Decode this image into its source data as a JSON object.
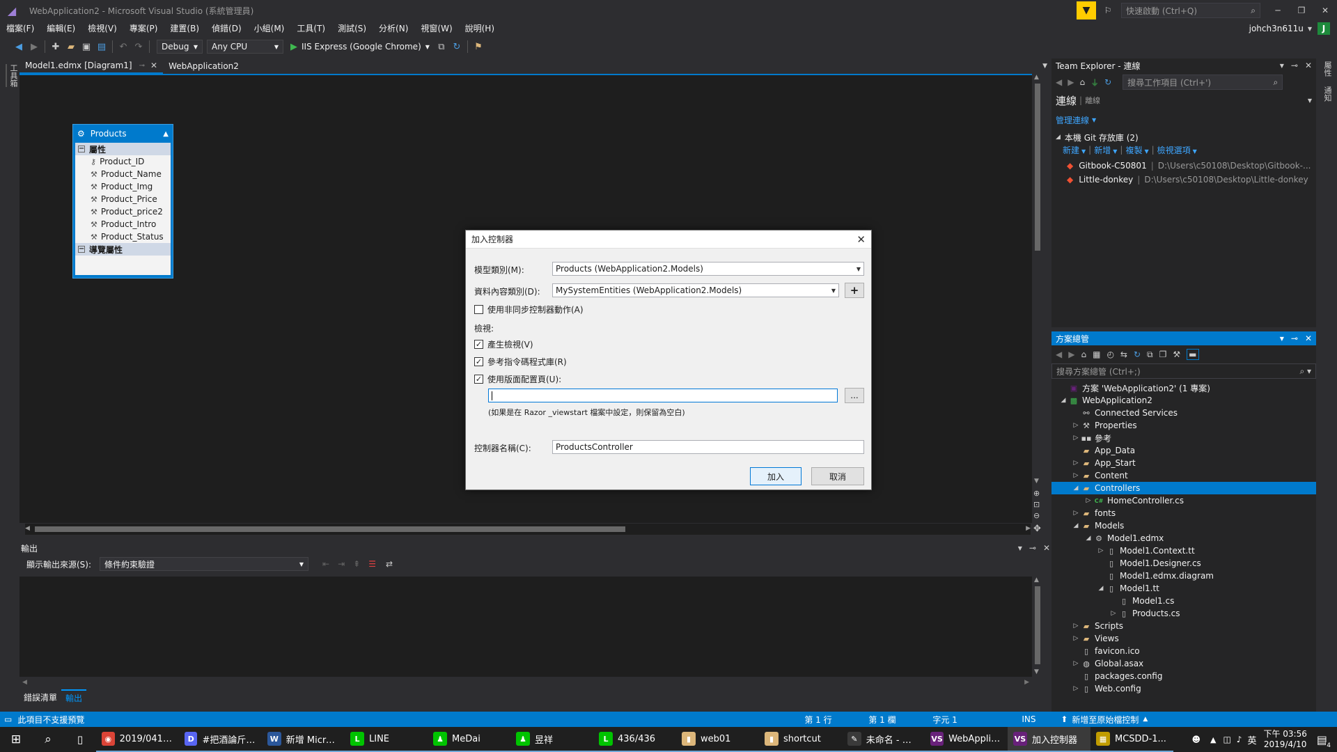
{
  "window": {
    "title": "WebApplication2 - Microsoft Visual Studio (系統管理員)",
    "quick_launch_placeholder": "快速啟動 (Ctrl+Q)",
    "user": "johch3n611u",
    "user_initial": "J"
  },
  "menu": [
    "檔案(F)",
    "編輯(E)",
    "檢視(V)",
    "專案(P)",
    "建置(B)",
    "偵錯(D)",
    "小組(M)",
    "工具(T)",
    "測試(S)",
    "分析(N)",
    "視窗(W)",
    "說明(H)"
  ],
  "toolbar": {
    "config": "Debug",
    "platform": "Any CPU",
    "run_target": "IIS Express (Google Chrome)"
  },
  "left_strip_label": "工具箱",
  "right_strip_labels": [
    "屬性",
    "通知"
  ],
  "doc_tabs": [
    {
      "label": "Model1.edmx [Diagram1]",
      "active": true
    },
    {
      "label": "WebApplication2",
      "active": false
    }
  ],
  "entity": {
    "name": "Products",
    "properties_header": "屬性",
    "properties": [
      "Product_ID",
      "Product_Name",
      "Product_Img",
      "Product_Price",
      "Product_price2",
      "Product_Intro",
      "Product_Status"
    ],
    "nav_header": "導覽屬性"
  },
  "dialog": {
    "title": "加入控制器",
    "model_class_label": "模型類別(M):",
    "model_class_value": "Products (WebApplication2.Models)",
    "context_class_label": "資料內容類別(D):",
    "context_class_value": "MySystemEntities (WebApplication2.Models)",
    "add_context_button": "+",
    "async_label": "使用非同步控制器動作(A)",
    "async_checked": false,
    "views_label": "檢視:",
    "generate_views_label": "產生檢視(V)",
    "generate_views_checked": true,
    "script_libs_label": "參考指令碼程式庫(R)",
    "script_libs_checked": true,
    "use_layout_label": "使用版面配置頁(U):",
    "use_layout_checked": true,
    "layout_value": "",
    "browse_button": "...",
    "layout_hint": "(如果是在 Razor _viewstart 檔案中設定，則保留為空白)",
    "controller_name_label": "控制器名稱(C):",
    "controller_name_value": "ProductsController",
    "add_button": "加入",
    "cancel_button": "取消"
  },
  "output": {
    "title": "輸出",
    "source_label": "顯示輸出來源(S):",
    "source_value": "條件約束驗證"
  },
  "bottom_tabs": [
    "錯誤清單",
    "輸出"
  ],
  "team_explorer": {
    "title": "Team Explorer - 連線",
    "search_placeholder": "搜尋工作項目 (Ctrl+')",
    "heading": "連線",
    "heading_sub": "離線",
    "manage_link": "管理連線",
    "repos_header": "本機 Git 存放庫 (2)",
    "actions": [
      "新建",
      "新增",
      "複製",
      "檢視選項"
    ],
    "repos": [
      {
        "name": "Gitbook-C50801",
        "path": "D:\\Users\\c50108\\Desktop\\Gitbook-..."
      },
      {
        "name": "Little-donkey",
        "path": "D:\\Users\\c50108\\Desktop\\Little-donkey"
      }
    ]
  },
  "solution_explorer": {
    "title": "方案總管",
    "search_placeholder": "搜尋方案總管 (Ctrl+;)",
    "items": [
      {
        "label": "方案 'WebApplication2' (1 專案)",
        "level": 0,
        "arrow": "",
        "icon": "sln"
      },
      {
        "label": "WebApplication2",
        "level": 0,
        "arrow": "down",
        "icon": "proj"
      },
      {
        "label": "Connected Services",
        "level": 1,
        "arrow": "",
        "icon": "svc"
      },
      {
        "label": "Properties",
        "level": 1,
        "arrow": "right",
        "icon": "wrench"
      },
      {
        "label": "參考",
        "level": 1,
        "arrow": "right",
        "icon": "ref"
      },
      {
        "label": "App_Data",
        "level": 1,
        "arrow": "",
        "icon": "folder"
      },
      {
        "label": "App_Start",
        "level": 1,
        "arrow": "right",
        "icon": "folder"
      },
      {
        "label": "Content",
        "level": 1,
        "arrow": "right",
        "icon": "folder"
      },
      {
        "label": "Controllers",
        "level": 1,
        "arrow": "down",
        "icon": "folder",
        "selected": true
      },
      {
        "label": "HomeController.cs",
        "level": 2,
        "arrow": "right",
        "icon": "cs"
      },
      {
        "label": "fonts",
        "level": 1,
        "arrow": "right",
        "icon": "folder"
      },
      {
        "label": "Models",
        "level": 1,
        "arrow": "down",
        "icon": "folder"
      },
      {
        "label": "Model1.edmx",
        "level": 2,
        "arrow": "down",
        "icon": "edmx"
      },
      {
        "label": "Model1.Context.tt",
        "level": 3,
        "arrow": "right",
        "icon": "file"
      },
      {
        "label": "Model1.Designer.cs",
        "level": 3,
        "arrow": "",
        "icon": "file"
      },
      {
        "label": "Model1.edmx.diagram",
        "level": 3,
        "arrow": "",
        "icon": "file"
      },
      {
        "label": "Model1.tt",
        "level": 3,
        "arrow": "down",
        "icon": "file"
      },
      {
        "label": "Model1.cs",
        "level": 4,
        "arrow": "",
        "icon": "file"
      },
      {
        "label": "Products.cs",
        "level": 4,
        "arrow": "right",
        "icon": "file"
      },
      {
        "label": "Scripts",
        "level": 1,
        "arrow": "right",
        "icon": "folder"
      },
      {
        "label": "Views",
        "level": 1,
        "arrow": "right",
        "icon": "folder"
      },
      {
        "label": "favicon.ico",
        "level": 1,
        "arrow": "",
        "icon": "file"
      },
      {
        "label": "Global.asax",
        "level": 1,
        "arrow": "right",
        "icon": "global"
      },
      {
        "label": "packages.config",
        "level": 1,
        "arrow": "",
        "icon": "file"
      },
      {
        "label": "Web.config",
        "level": 1,
        "arrow": "right",
        "icon": "file"
      }
    ]
  },
  "status": {
    "message": "此項目不支援預覽",
    "line": "第 1 行",
    "col": "第 1 欄",
    "char": "字元 1",
    "mode": "INS",
    "source_control": "新增至原始檔控制"
  },
  "taskbar": {
    "apps": [
      {
        "label": "2019/0410...",
        "color": "#db4437",
        "glyph": "◉"
      },
      {
        "label": "#把酒論斤 -...",
        "color": "#5865f2",
        "glyph": "D"
      },
      {
        "label": "新增 Micro...",
        "color": "#2b579a",
        "glyph": "W"
      },
      {
        "label": "LINE",
        "color": "#00c300",
        "glyph": "L"
      },
      {
        "label": "MeDai",
        "color": "#00c300",
        "glyph": "♟"
      },
      {
        "label": "昱祥",
        "color": "#00c300",
        "glyph": "♟"
      },
      {
        "label": "436/436",
        "color": "#00c300",
        "glyph": "L"
      },
      {
        "label": "web01",
        "color": "#dcb67a",
        "glyph": "▮"
      },
      {
        "label": "shortcut",
        "color": "#dcb67a",
        "glyph": "▮"
      },
      {
        "label": "未命名 - 小...",
        "color": "#3a3a3a",
        "glyph": "✎"
      },
      {
        "label": "WebApplic...",
        "color": "#68217a",
        "glyph": "VS"
      },
      {
        "label": "加入控制器",
        "color": "#68217a",
        "glyph": "VS"
      },
      {
        "label": "MCSDD-1...",
        "color": "#c19c00",
        "glyph": "▦"
      }
    ],
    "ime": "英",
    "time": "下午 03:56",
    "date": "2019/4/10",
    "notif_count": "4"
  },
  "colors": {
    "accent": "#007acc",
    "chrome": "#2d2d30",
    "editor": "#1e1e1e",
    "filter": "#ffcc00"
  }
}
